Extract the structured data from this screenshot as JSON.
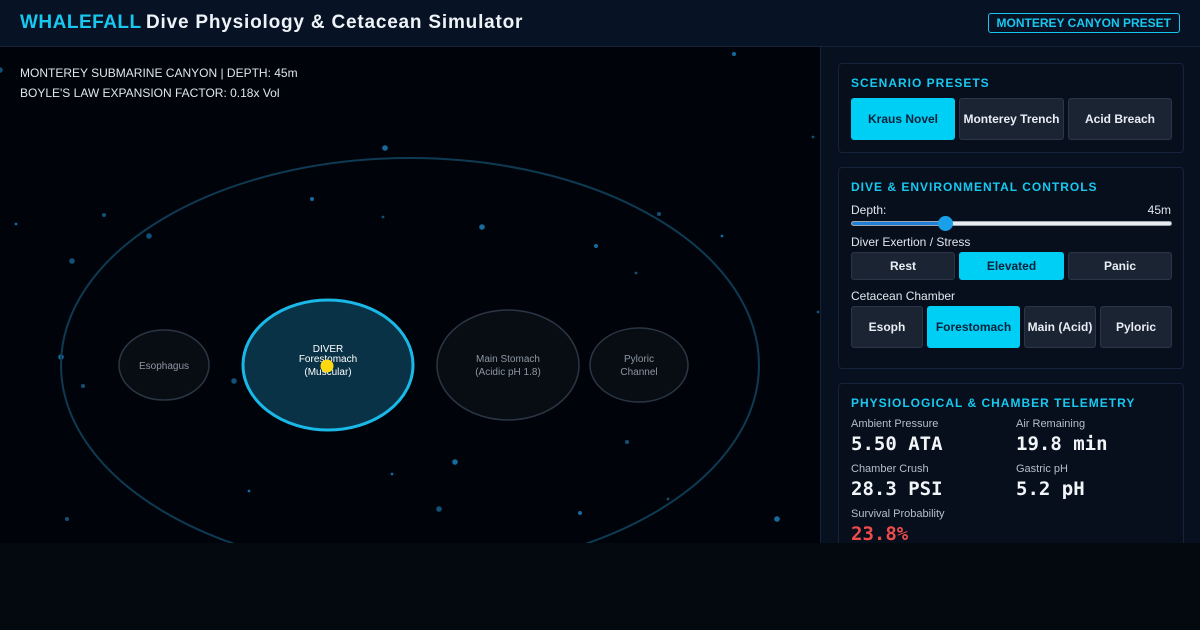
{
  "header": {
    "brand": "WHALEFALL",
    "title": "Dive Physiology & Cetacean Simulator",
    "preset_badge": "MONTEREY CANYON PRESET"
  },
  "sim": {
    "location_line": "MONTEREY SUBMARINE CANYON | DEPTH: 45m",
    "boyle_line": "BOYLE'S LAW EXPANSION FACTOR: 0.18x Vol",
    "chambers": {
      "esophagus": "Esophagus",
      "forestomach_line1": "DIVER",
      "forestomach_line2": "Forestomach",
      "forestomach_line3": "(Muscular)",
      "main_stomach_line1": "Main Stomach",
      "main_stomach_line2": "(Acidic pH 1.8)",
      "pyloric_line1": "Pyloric",
      "pyloric_line2": "Channel"
    },
    "colors": {
      "active_chamber": "#1ab8e6",
      "diver": "#ffd814",
      "particles": "#1a86c0"
    }
  },
  "presets": {
    "title": "SCENARIO PRESETS",
    "buttons": [
      "Kraus Novel",
      "Monterey Trench",
      "Acid Breach"
    ]
  },
  "controls": {
    "title": "DIVE & ENVIRONMENTAL CONTROLS",
    "depth_label": "Depth:",
    "depth_value": "45m",
    "depth_fraction": 0.29,
    "exertion_label": "Diver Exertion / Stress",
    "exertion_options": [
      "Rest",
      "Elevated",
      "Panic"
    ],
    "chamber_label": "Cetacean Chamber",
    "chamber_options": [
      "Esoph",
      "Forestomach",
      "Main (Acid)",
      "Pyloric"
    ]
  },
  "telemetry": {
    "title": "PHYSIOLOGICAL & CHAMBER TELEMETRY",
    "ambient_pressure_label": "Ambient Pressure",
    "ambient_pressure_value": "5.50 ATA",
    "air_remaining_label": "Air Remaining",
    "air_remaining_value": "19.8 min",
    "chamber_crush_label": "Chamber Crush",
    "chamber_crush_value": "28.3 PSI",
    "gastric_ph_label": "Gastric pH",
    "gastric_ph_value": "5.2 pH",
    "survival_label": "Survival Probability",
    "survival_value": "23.8%",
    "danger_color": "#ef4b4b"
  },
  "accent_color": "#18c8f0"
}
